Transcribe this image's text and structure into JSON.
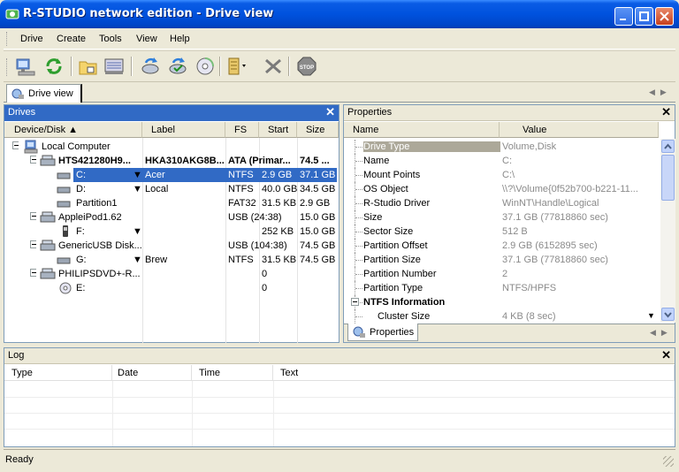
{
  "window": {
    "title": "R-STUDIO network edition - Drive view"
  },
  "menu": [
    "Drive",
    "Create",
    "Tools",
    "View",
    "Help"
  ],
  "tabs": {
    "main": "Drive view",
    "properties": "Properties"
  },
  "drives": {
    "title": "Drives",
    "columns": [
      "Device/Disk",
      "Label",
      "FS",
      "Start",
      "Size"
    ],
    "rows": [
      {
        "name": "Local Computer",
        "label": "",
        "fs": "",
        "start": "",
        "size": ""
      },
      {
        "name": "HTS421280H9...",
        "label": "HKA310AKG8B...",
        "fs": "ATA (Primar...",
        "start": "",
        "size": "74.5 ..."
      },
      {
        "name": "C:",
        "label": "Acer",
        "fs": "NTFS",
        "start": "2.9 GB",
        "size": "37.1 GB"
      },
      {
        "name": "D:",
        "label": "Local",
        "fs": "NTFS",
        "start": "40.0 GB",
        "size": "34.5 GB"
      },
      {
        "name": "Partition1",
        "label": "",
        "fs": "FAT32",
        "start": "31.5 KB",
        "size": "2.9 GB"
      },
      {
        "name": "AppleiPod1.62",
        "label": "",
        "fs": "USB (24:38)",
        "start": "",
        "size": "15.0 GB"
      },
      {
        "name": "F:",
        "label": "",
        "fs": "",
        "start": "252 KB",
        "size": "15.0 GB"
      },
      {
        "name": "GenericUSB Disk...",
        "label": "",
        "fs": "USB (104:38)",
        "start": "",
        "size": "74.5 GB"
      },
      {
        "name": "G:",
        "label": "Brew",
        "fs": "NTFS",
        "start": "31.5 KB",
        "size": "74.5 GB"
      },
      {
        "name": "PHILIPSDVD+-R...",
        "label": "",
        "fs": "",
        "start": "0",
        "size": ""
      },
      {
        "name": "E:",
        "label": "",
        "fs": "",
        "start": "0",
        "size": ""
      }
    ]
  },
  "properties": {
    "title": "Properties",
    "columns": [
      "Name",
      "Value"
    ],
    "rows": [
      {
        "name": "Drive Type",
        "value": "Volume,Disk"
      },
      {
        "name": "Name",
        "value": "C:"
      },
      {
        "name": "Mount Points",
        "value": "C:\\"
      },
      {
        "name": "OS Object",
        "value": "\\\\?\\Volume{0f52b700-b221-11..."
      },
      {
        "name": "R-Studio Driver",
        "value": "WinNT\\Handle\\Logical"
      },
      {
        "name": "Size",
        "value": "37.1 GB (77818860 sec)"
      },
      {
        "name": "Sector Size",
        "value": "512 B"
      },
      {
        "name": "Partition Offset",
        "value": "2.9 GB (6152895 sec)"
      },
      {
        "name": "Partition Size",
        "value": "37.1 GB (77818860 sec)"
      },
      {
        "name": "Partition Number",
        "value": "2"
      },
      {
        "name": "Partition Type",
        "value": "NTFS/HPFS"
      },
      {
        "name": "NTFS Information",
        "value": ""
      },
      {
        "name": "Cluster Size",
        "value": "4 KB (8 sec)"
      }
    ]
  },
  "log": {
    "title": "Log",
    "columns": [
      "Type",
      "Date",
      "Time",
      "Text"
    ]
  },
  "status": {
    "text": "Ready"
  },
  "colors": {
    "title_bar": "#0052DE",
    "selection": "#316AC5",
    "panel_bg": "#ECE9D8"
  }
}
